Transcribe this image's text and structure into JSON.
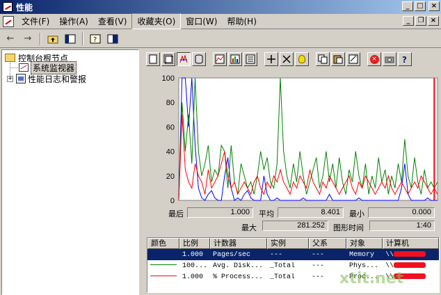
{
  "window": {
    "title": "性能",
    "minimize_label": "_",
    "maximize_label": "□",
    "close_label": "×"
  },
  "menubar": {
    "items": [
      {
        "label": "文件(F)"
      },
      {
        "label": "操作(A)"
      },
      {
        "label": "查看(V)"
      },
      {
        "label": "收藏夹(O)"
      },
      {
        "label": "窗口(W)"
      },
      {
        "label": "帮助(H)"
      }
    ],
    "active_index": 3,
    "mdi_minimize": "_",
    "mdi_restore": "❐",
    "mdi_close": "×"
  },
  "tree": {
    "root_label": "控制台根节点",
    "child1_label": "系统监视器",
    "child2_label": "性能日志和警报",
    "expander_plus": "+"
  },
  "chart_data": {
    "type": "line",
    "yticks": [
      "100",
      "80",
      "60",
      "40",
      "20",
      "0"
    ],
    "ylim": [
      0,
      100
    ],
    "series": [
      {
        "name": "Pages/sec",
        "color": "#0000ff",
        "values": [
          0,
          100,
          100,
          60,
          100,
          45,
          10,
          2,
          0,
          5,
          8,
          2,
          0,
          0,
          20,
          35,
          10,
          0,
          2,
          0,
          5,
          8,
          2,
          0,
          0,
          0,
          20,
          5,
          0,
          0,
          2,
          0,
          0,
          0,
          0,
          0,
          0,
          0,
          2,
          0,
          0,
          0,
          0,
          0,
          0,
          0,
          5,
          0,
          0,
          0,
          0,
          0,
          0,
          0,
          0,
          2,
          0,
          0,
          0,
          0,
          0,
          0,
          0,
          0,
          0,
          0,
          0,
          0,
          10,
          30,
          5,
          0,
          0,
          0,
          0,
          0,
          2,
          0,
          0,
          0
        ]
      },
      {
        "name": "Avg. Disk...",
        "color": "#008000",
        "values": [
          0,
          80,
          40,
          70,
          30,
          100,
          40,
          20,
          30,
          45,
          15,
          25,
          20,
          45,
          40,
          10,
          45,
          15,
          5,
          30,
          20,
          10,
          15,
          5,
          20,
          40,
          25,
          35,
          15,
          10,
          30,
          100,
          40,
          20,
          10,
          30,
          15,
          40,
          20,
          5,
          15,
          25,
          35,
          10,
          20,
          40,
          15,
          30,
          10,
          35,
          15,
          5,
          25,
          15,
          40,
          20,
          10,
          30,
          5,
          20,
          10,
          35,
          15,
          25,
          5,
          20,
          10,
          30,
          15,
          50,
          20,
          10,
          35,
          15,
          5,
          25,
          10,
          15,
          10,
          15
        ]
      },
      {
        "name": "% Process...",
        "color": "#ff0000",
        "values": [
          0,
          70,
          25,
          15,
          10,
          30,
          20,
          15,
          5,
          25,
          10,
          15,
          20,
          30,
          40,
          20,
          10,
          15,
          5,
          10,
          15,
          10,
          5,
          15,
          20,
          10,
          5,
          15,
          10,
          20,
          15,
          25,
          15,
          10,
          5,
          15,
          10,
          20,
          15,
          10,
          25,
          15,
          10,
          5,
          15,
          10,
          20,
          15,
          10,
          5,
          10,
          15,
          20,
          10,
          5,
          15,
          10,
          20,
          15,
          10,
          5,
          10,
          15,
          10,
          20,
          10,
          5,
          10,
          15,
          10,
          5,
          10,
          15,
          10,
          20,
          15,
          10,
          5,
          10,
          5
        ]
      }
    ],
    "time_bar_index": 78,
    "time_bar_color": "#ff0000"
  },
  "stats": {
    "last_label": "最后",
    "last_value": "1.000",
    "avg_label": "平均",
    "avg_value": "8.401",
    "min_label": "最小",
    "min_value": "0.000",
    "max_label": "最大",
    "max_value": "281.252",
    "duration_label": "图形时间",
    "duration_value": "1:40"
  },
  "legend": {
    "headers": {
      "color": "颜色",
      "scale": "比例",
      "counter": "计数器",
      "instance": "实例",
      "parent": "父系",
      "object": "对象",
      "computer": "计算机"
    },
    "rows": [
      {
        "color": "#0000ff",
        "scale": "1.000",
        "counter": "Pages/sec",
        "instance": "---",
        "parent": "---",
        "object": "Memory",
        "computer": "\\\\"
      },
      {
        "color": "#008000",
        "scale": "100...",
        "counter": "Avg. Disk...",
        "instance": "_Total",
        "parent": "---",
        "object": "Phys...",
        "computer": "\\\\"
      },
      {
        "color": "#ff0000",
        "scale": "1.000",
        "counter": "% Process...",
        "instance": "_Total",
        "parent": "---",
        "object": "Proc...",
        "computer": "\\\\"
      }
    ]
  },
  "watermark": "xtit.net"
}
